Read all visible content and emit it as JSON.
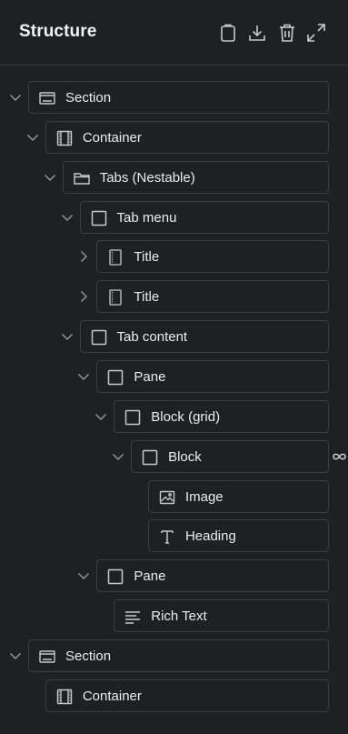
{
  "panel": {
    "title": "Structure",
    "actions": [
      {
        "icon": "clipboard-icon"
      },
      {
        "icon": "download-icon"
      },
      {
        "icon": "trash-icon"
      },
      {
        "icon": "expand-icon"
      }
    ]
  },
  "tree": [
    {
      "label": "Section",
      "icon": "section-icon",
      "level": 0,
      "chevron": "down"
    },
    {
      "label": "Container",
      "icon": "container-icon",
      "level": 1,
      "chevron": "down"
    },
    {
      "label": "Tabs (Nestable)",
      "icon": "folder-icon",
      "level": 2,
      "chevron": "down"
    },
    {
      "label": "Tab menu",
      "icon": "block-icon",
      "level": 3,
      "chevron": "down"
    },
    {
      "label": "Title",
      "icon": "text-block-icon",
      "level": 4,
      "chevron": "right"
    },
    {
      "label": "Title",
      "icon": "text-block-icon",
      "level": 4,
      "chevron": "right"
    },
    {
      "label": "Tab content",
      "icon": "block-icon",
      "level": 3,
      "chevron": "down"
    },
    {
      "label": "Pane",
      "icon": "block-icon",
      "level": 4,
      "chevron": "down"
    },
    {
      "label": "Block (grid)",
      "icon": "block-icon",
      "level": 5,
      "chevron": "down"
    },
    {
      "label": "Block",
      "icon": "block-icon",
      "level": 6,
      "chevron": "down",
      "linked": true
    },
    {
      "label": "Image",
      "icon": "image-icon",
      "level": 7,
      "chevron": "none"
    },
    {
      "label": "Heading",
      "icon": "heading-icon",
      "level": 7,
      "chevron": "none"
    },
    {
      "label": "Pane",
      "icon": "block-icon",
      "level": 4,
      "chevron": "down"
    },
    {
      "label": "Rich Text",
      "icon": "rich-text-icon",
      "level": 5,
      "chevron": "none"
    },
    {
      "label": "Section",
      "icon": "section-icon",
      "level": 0,
      "chevron": "down"
    },
    {
      "label": "Container",
      "icon": "container-icon",
      "level": 1,
      "chevron": "none"
    }
  ]
}
